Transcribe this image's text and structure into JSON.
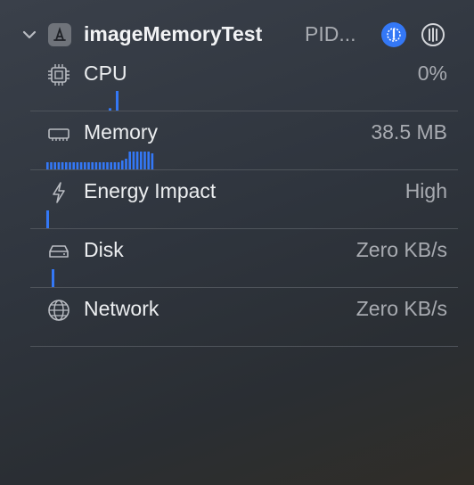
{
  "process": {
    "name": "imageMemoryTest",
    "pid_label": "PID...",
    "icons": {
      "disclosure": "chevron-down-icon",
      "app": "app-store-a-icon",
      "debug": "debug-gauge-icon",
      "threads": "threads-icon"
    },
    "colors": {
      "accent": "#3478f6"
    }
  },
  "gauges": [
    {
      "key": "cpu",
      "label": "CPU",
      "value": "0%",
      "icon": "cpu-chip-icon",
      "graph": [
        0.12,
        1.0
      ]
    },
    {
      "key": "memory",
      "label": "Memory",
      "value": "38.5 MB",
      "icon": "memory-module-icon",
      "graph": [
        0.4,
        0.4,
        0.4,
        0.4,
        0.4,
        0.4,
        0.4,
        0.4,
        0.4,
        0.4,
        0.4,
        0.4,
        0.4,
        0.4,
        0.4,
        0.4,
        0.4,
        0.4,
        0.4,
        0.4,
        0.5,
        0.6,
        1.0,
        1.0,
        1.0,
        1.0,
        1.0,
        1.0,
        0.9
      ]
    },
    {
      "key": "energy",
      "label": "Energy Impact",
      "value": "High",
      "icon": "lightning-bolt-icon",
      "graph": [
        1.0
      ]
    },
    {
      "key": "disk",
      "label": "Disk",
      "value": "Zero KB/s",
      "icon": "disk-drive-icon",
      "graph": [
        1.0
      ]
    },
    {
      "key": "network",
      "label": "Network",
      "value": "Zero KB/s",
      "icon": "globe-network-icon",
      "graph": []
    }
  ]
}
